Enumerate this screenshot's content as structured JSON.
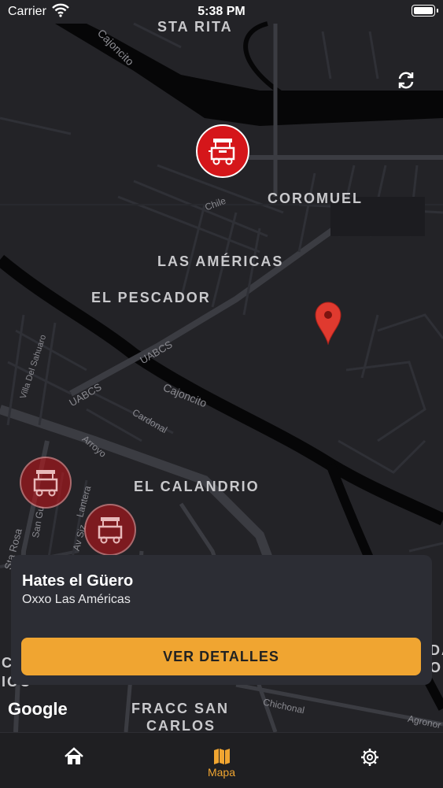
{
  "status_bar": {
    "carrier": "Carrier",
    "time": "5:38 PM"
  },
  "map": {
    "neighborhoods": [
      "STA RITA",
      "COROMUEL",
      "LAS AMÉRICAS",
      "EL PESCADOR",
      "EL CALANDRIO",
      "FRACC SAN",
      "CARLOS",
      "C",
      "IOO",
      "DA",
      "O"
    ],
    "streets": [
      "Cajoncito",
      "Chile",
      "UABCS",
      "UABCS",
      "Cajoncito",
      "Villa Del Sahuaro",
      "Cardonal",
      "Arroyo",
      "Lantera",
      "Av Siz",
      "San Gu",
      "Sta Rosa",
      "Chichonal",
      "Agronor"
    ],
    "attribution": "Google"
  },
  "selected_place": {
    "title": "Hates el Güero",
    "subtitle": "Oxxo Las Américas",
    "details_button": "VER DETALLES"
  },
  "tabbar": {
    "tabs": [
      {
        "label": "",
        "icon": "home-icon",
        "active": false
      },
      {
        "label": "Mapa",
        "icon": "map-icon",
        "active": true
      },
      {
        "label": "",
        "icon": "gear-icon",
        "active": false
      }
    ]
  },
  "colors": {
    "accent": "#f0a531",
    "marker": "#d5161a",
    "map_bg": "#232327",
    "card_bg": "#2c2d34"
  }
}
